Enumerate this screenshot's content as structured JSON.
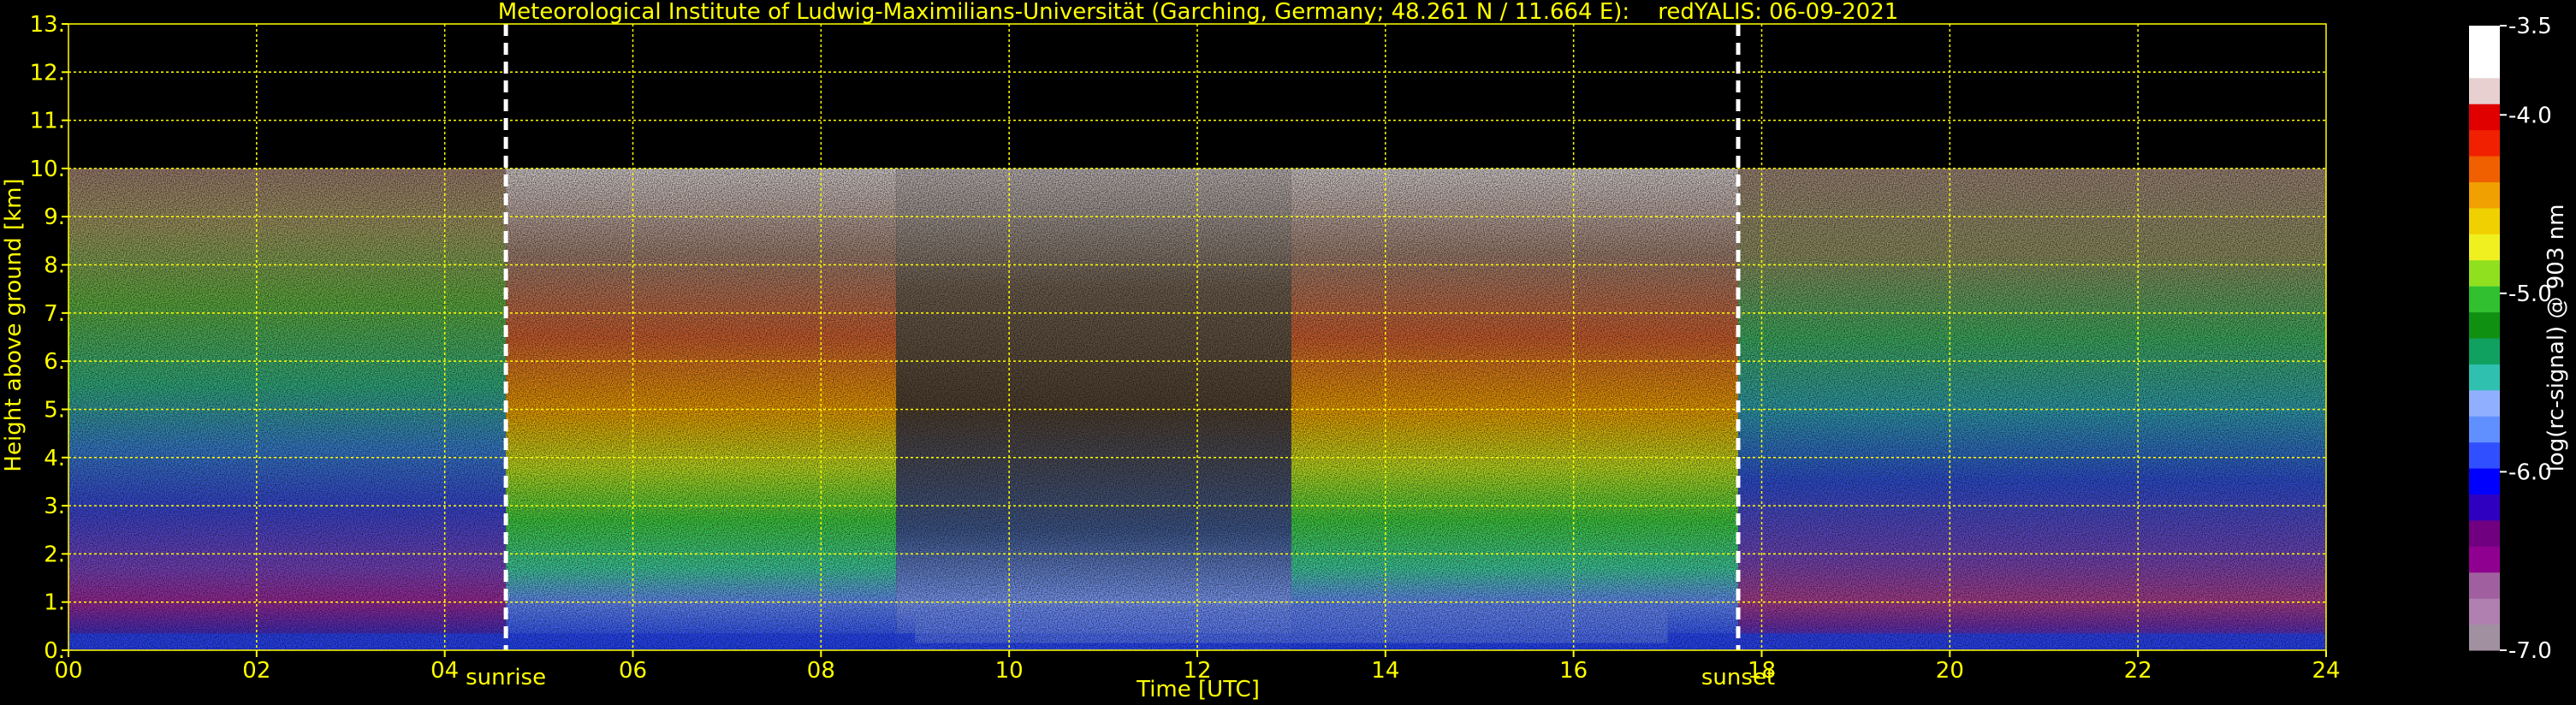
{
  "chart_data": {
    "type": "heatmap",
    "title": "Meteorological Institute of Ludwig-Maximilians-Universität (Garching, Germany; 48.261 N / 11.664 E):    redYALIS: 06-09-2021",
    "xlabel": "Time [UTC]",
    "ylabel": "Height above ground [km]",
    "xlim": [
      0,
      24
    ],
    "ylim": [
      0,
      13
    ],
    "x_ticks": [
      "00",
      "02",
      "04",
      "06",
      "08",
      "10",
      "12",
      "14",
      "16",
      "18",
      "20",
      "22",
      "24"
    ],
    "y_ticks": [
      "0.",
      "1.",
      "2.",
      "3.",
      "4.",
      "5.",
      "6.",
      "7.",
      "8.",
      "9.",
      "10.",
      "11.",
      "12.",
      "13."
    ],
    "grid": true,
    "grid_color": "#ffff00",
    "data_top_km": 10,
    "markers": [
      {
        "label": "sunrise",
        "time": 4.65
      },
      {
        "label": "sunset",
        "time": 17.75
      }
    ],
    "colorbar": {
      "label": "log(rc-signal) @ 903 nm",
      "range": [
        -7.0,
        -3.5
      ],
      "ticks": [
        "-3.5",
        "-4.0",
        "-5.0",
        "-6.0",
        "-7.0"
      ],
      "tick_values": [
        -3.5,
        -4.0,
        -5.0,
        -6.0,
        -7.0
      ],
      "colors": [
        "#a090a0",
        "#b080b0",
        "#a060a0",
        "#900090",
        "#700080",
        "#3000c0",
        "#0000ff",
        "#3050ff",
        "#6090ff",
        "#90b0ff",
        "#30c0b0",
        "#10a060",
        "#109010",
        "#30c030",
        "#90e020",
        "#f0f020",
        "#f0d000",
        "#f0a000",
        "#f06000",
        "#f02000",
        "#e00000",
        "#e8d0d0",
        "#ffffff",
        "#ffffff"
      ]
    }
  }
}
